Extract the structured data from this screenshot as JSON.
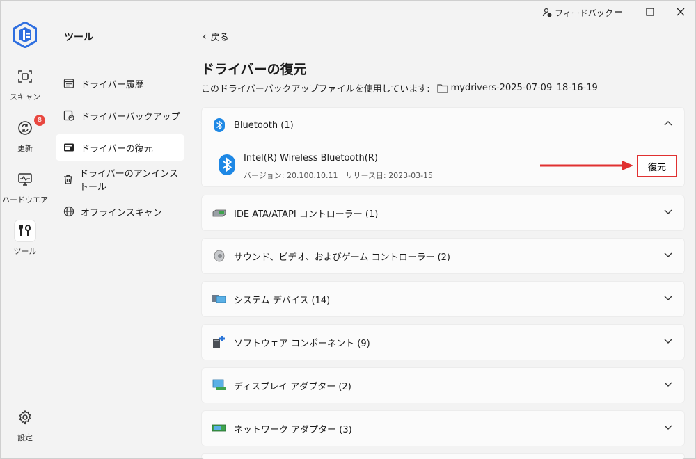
{
  "rail": {
    "items": [
      {
        "label": "スキャン",
        "icon": "scan-icon"
      },
      {
        "label": "更新",
        "icon": "update-icon",
        "badge": "8"
      },
      {
        "label": "ハードウエア",
        "icon": "hardware-icon"
      },
      {
        "label": "ツール",
        "icon": "tools-icon",
        "active": true
      }
    ],
    "settings_label": "設定"
  },
  "nav": {
    "title": "ツール",
    "items": [
      {
        "label": "ドライバー履歴",
        "icon": "history-icon"
      },
      {
        "label": "ドライバーバックアップ",
        "icon": "backup-icon"
      },
      {
        "label": "ドライバーの復元",
        "icon": "restore-icon",
        "active": true
      },
      {
        "label": "ドライバーのアンインストール",
        "icon": "trash-icon"
      },
      {
        "label": "オフラインスキャン",
        "icon": "globe-icon"
      }
    ]
  },
  "titlebar": {
    "feedback_label": "フィードバック"
  },
  "main": {
    "back_label": "戻る",
    "title": "ドライバーの復元",
    "file_prefix": "このドライバーバックアップファイルを使用しています:",
    "file_name": "mydrivers-2025-07-09_18-16-19",
    "categories": [
      {
        "label": "Bluetooth (1)",
        "icon": "bluetooth-icon",
        "expanded": true,
        "driver": {
          "name": "Intel(R) Wireless Bluetooth(R)",
          "meta": "バージョン: 20.100.10.11　リリース日: 2023-03-15",
          "action_label": "復元"
        }
      },
      {
        "label": "IDE ATA/ATAPI コントローラー (1)",
        "icon": "ide-controller-icon"
      },
      {
        "label": "サウンド、ビデオ、およびゲーム コントローラー (2)",
        "icon": "speaker-icon"
      },
      {
        "label": "システム デバイス (14)",
        "icon": "system-device-icon"
      },
      {
        "label": "ソフトウェア コンポーネント (9)",
        "icon": "software-component-icon"
      },
      {
        "label": "ディスプレイ アダプター (2)",
        "icon": "display-adapter-icon"
      },
      {
        "label": "ネットワーク アダプター (3)",
        "icon": "network-adapter-icon"
      }
    ]
  },
  "colors": {
    "accent": "#1e88e5",
    "highlight": "#e03131",
    "badge": "#e8473f"
  }
}
